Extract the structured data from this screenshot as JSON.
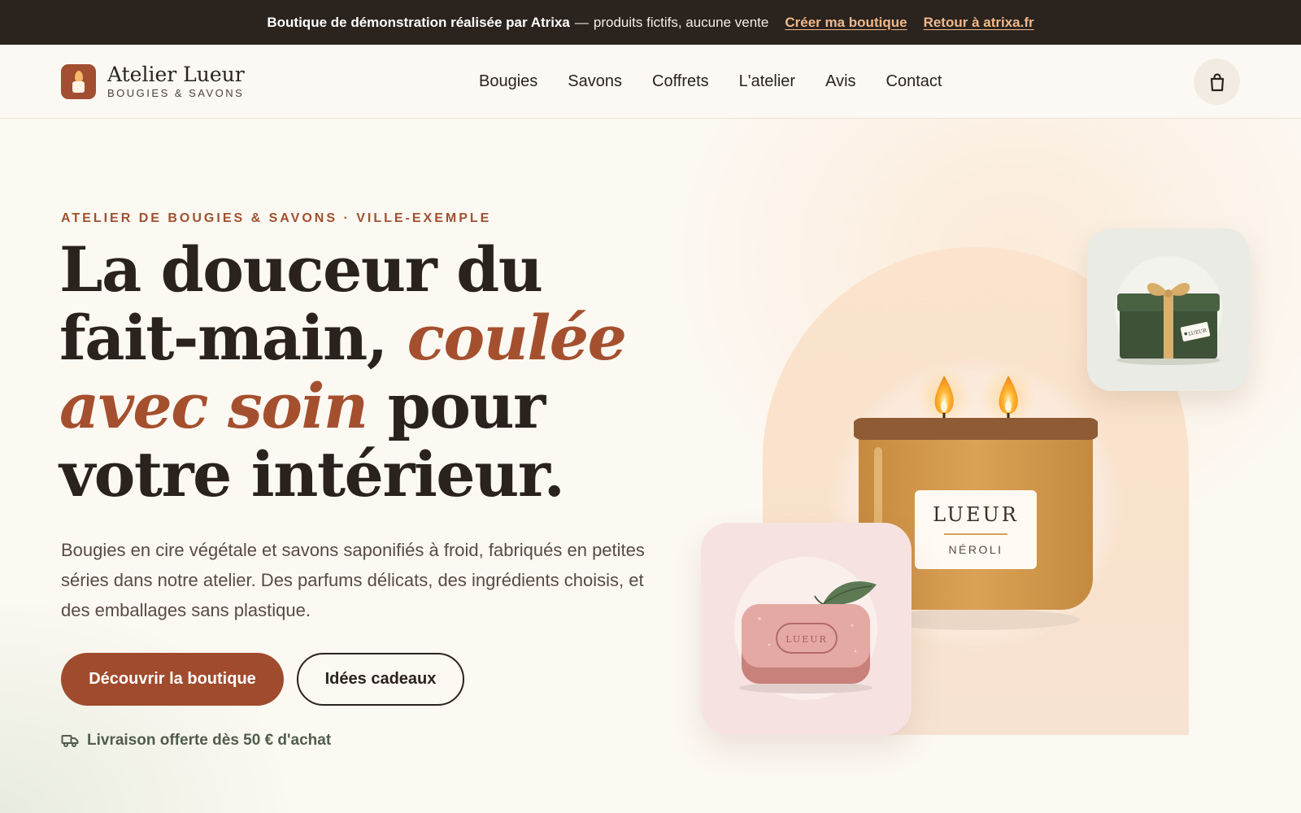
{
  "topbar": {
    "message_strong": "Boutique de démonstration réalisée par Atrixa",
    "message_dash": "—",
    "message_rest": "produits fictifs, aucune vente",
    "link_create": "Créer ma boutique",
    "link_back": "Retour à atrixa.fr"
  },
  "header": {
    "brand_name": "Atelier Lueur",
    "brand_tagline": "BOUGIES & SAVONS",
    "nav": [
      "Bougies",
      "Savons",
      "Coffrets",
      "L'atelier",
      "Avis",
      "Contact"
    ],
    "cart_icon": "shopping-bag-icon"
  },
  "hero": {
    "eyebrow": "ATELIER DE BOUGIES & SAVONS · VILLE-EXEMPLE",
    "title_part1": "La douceur du fait-main, ",
    "title_emphasis": "coulée avec soin",
    "title_part2": " pour votre intérieur.",
    "description": "Bougies en cire végétale et savons saponifiés à froid, fabriqués en petites séries dans notre atelier. Des parfums délicats, des ingrédients choisis, et des emballages sans plastique.",
    "cta_primary": "Découvrir la boutique",
    "cta_secondary": "Idées cadeaux",
    "shipping_note": "Livraison offerte dès 50 € d'achat",
    "shipping_icon": "truck-icon"
  },
  "illustration": {
    "candle_label": "LUEUR",
    "candle_scent": "NÉROLI",
    "soap_stamp": "LUEUR",
    "gift_tag": "LUEUR"
  },
  "colors": {
    "accent": "#a24e30",
    "topbar_bg": "#2a231e",
    "topbar_link": "#f0b98a",
    "page_bg": "#fcf8f2",
    "shipping_text": "#4f5d4a"
  }
}
